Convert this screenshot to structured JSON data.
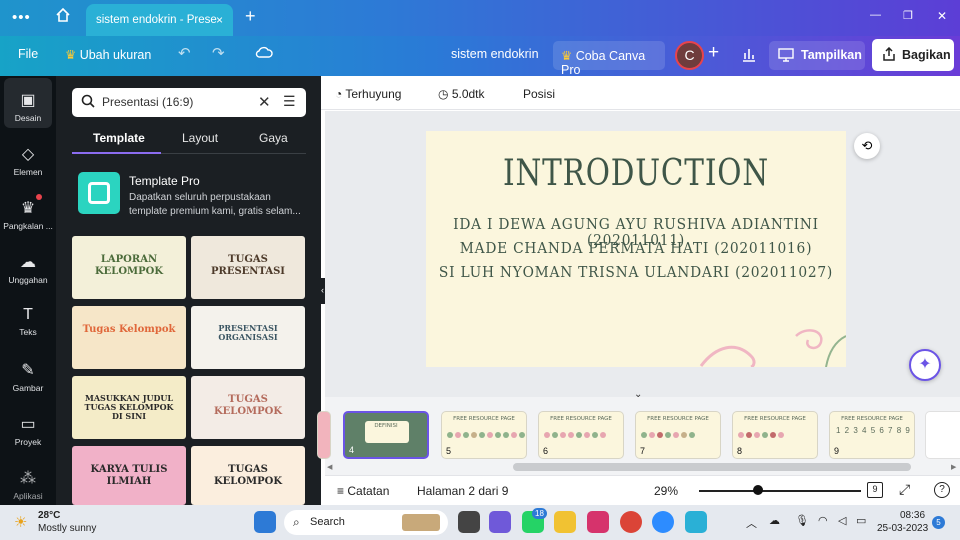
{
  "browser": {
    "tab_title": "sistem endokrin - Prese",
    "new_tab": "+",
    "close": "×",
    "win_minimize": "—",
    "win_restore": "❐",
    "win_close": "✕"
  },
  "header": {
    "file": "File",
    "resize": "Ubah ukuran",
    "doc_title": "sistem endokrin",
    "try_pro": "Coba Canva Pro",
    "avatar": "C",
    "add": "+",
    "present": "Tampilkan",
    "share": "Bagikan"
  },
  "rail": [
    {
      "label": "Desain",
      "icon": "layout-icon"
    },
    {
      "label": "Elemen",
      "icon": "shapes-icon"
    },
    {
      "label": "Pangkalan ...",
      "icon": "brand-icon"
    },
    {
      "label": "Unggahan",
      "icon": "upload-icon"
    },
    {
      "label": "Teks",
      "icon": "text-icon"
    },
    {
      "label": "Gambar",
      "icon": "draw-icon"
    },
    {
      "label": "Proyek",
      "icon": "folder-icon"
    },
    {
      "label": "Aplikasi",
      "icon": "apps-icon"
    }
  ],
  "panel": {
    "search_value": "Presentasi (16:9)",
    "tabs": [
      "Template",
      "Layout",
      "Gaya"
    ],
    "pro_title": "Template Pro",
    "pro_desc": "Dapatkan seluruh perpustakaan template premium kami, gratis selam...",
    "thumbs": [
      {
        "title": "LAPORAN KELOMPOK",
        "bg": "#f3f0d9"
      },
      {
        "title": "TUGAS PRESENTASI",
        "bg": "#efe8dc"
      },
      {
        "title": "Tugas Kelompok",
        "bg": "#f6e6c8"
      },
      {
        "title": "PRESENTASI ORGANISASI",
        "bg": "#f4f2ec"
      },
      {
        "title": "MASUKKAN JUDUL TUGAS KELOMPOK DI SINI",
        "bg": "#f4ecc8"
      },
      {
        "title": "TUGAS KELOMPOK",
        "bg": "#f3ece6"
      },
      {
        "title": "KARYA TULIS ILMIAH",
        "bg": "#f1b1c8"
      },
      {
        "title": "TUGAS KELOMPOK",
        "bg": "#fbeede"
      }
    ]
  },
  "toolbar": {
    "transition": "Terhuyung",
    "duration": "5.0dtk",
    "position": "Posisi"
  },
  "slide": {
    "title": "INTRODUCTION",
    "lines": [
      "IDA I DEWA AGUNG AYU RUSHIVA ADIANTINI (202011011)",
      "MADE CHANDA PERMATA HATI (202011016)",
      "SI LUH NYOMAN TRISNA ULANDARI (202011027)"
    ]
  },
  "filmstrip": [
    {
      "num": "4",
      "caption": "DEFINISI"
    },
    {
      "num": "5",
      "caption": "FREE RESOURCE PAGE"
    },
    {
      "num": "6",
      "caption": "FREE RESOURCE PAGE"
    },
    {
      "num": "7",
      "caption": "FREE RESOURCE PAGE"
    },
    {
      "num": "8",
      "caption": "FREE RESOURCE PAGE"
    },
    {
      "num": "9",
      "caption": "FREE RESOURCE PAGE"
    }
  ],
  "status": {
    "notes": "Catatan",
    "page": "Halaman 2 dari 9",
    "zoom": "29%",
    "zoom_level": 0.29,
    "pages": "9",
    "help": "?"
  },
  "taskbar": {
    "temp": "28°C",
    "weather": "Mostly sunny",
    "search": "Search",
    "whatsapp_badge": "18",
    "time": "08:36",
    "date": "25-03-2023",
    "notif": "5"
  }
}
